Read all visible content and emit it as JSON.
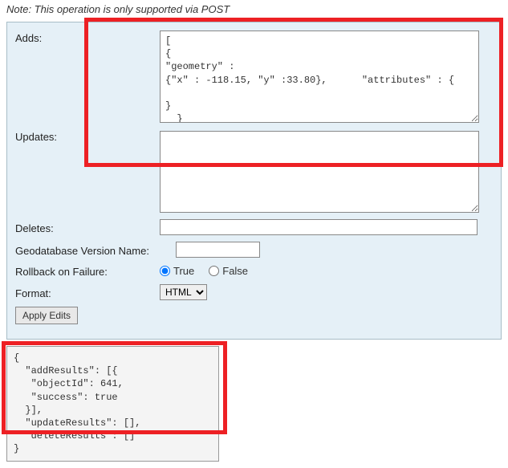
{
  "note": "Note: This operation is only supported via POST",
  "form": {
    "adds": {
      "label": "Adds:",
      "value": "[\n{\n\"geometry\" :\n{\"x\" : -118.15, \"y\" :33.80},      \"attributes\" : {\n\n}\n  }\n]"
    },
    "updates": {
      "label": "Updates:",
      "value": ""
    },
    "deletes": {
      "label": "Deletes:",
      "value": ""
    },
    "version": {
      "label": "Geodatabase Version Name:",
      "value": ""
    },
    "rollback": {
      "label": "Rollback on Failure:",
      "true_label": "True",
      "false_label": "False",
      "selected": "true"
    },
    "format": {
      "label": "Format:",
      "options": [
        "HTML"
      ],
      "selected": "HTML"
    },
    "submit_label": "Apply Edits"
  },
  "result_text": "{\n  \"addResults\": [{\n   \"objectId\": 641,\n   \"success\": true\n  }],\n  \"updateResults\": [],\n  \"deleteResults\": []\n}"
}
